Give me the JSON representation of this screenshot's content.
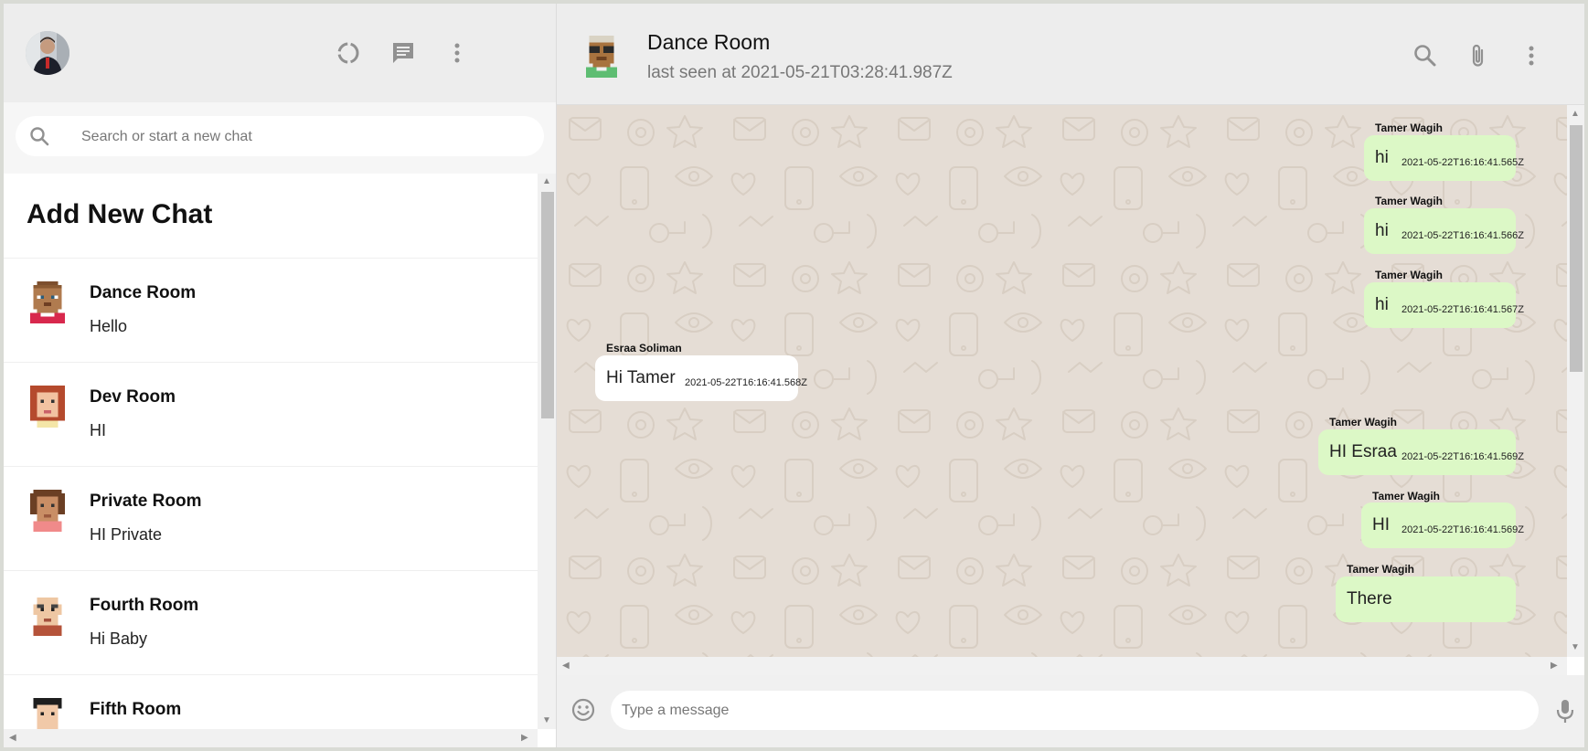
{
  "sidebar": {
    "search_placeholder": "Search or start a new chat",
    "add_new_chat_label": "Add New Chat",
    "chats": [
      {
        "name": "Dance Room",
        "last_message": "Hello",
        "avatar": "avatar-dark-skin-grey-hair"
      },
      {
        "name": "Dev Room",
        "last_message": "HI",
        "avatar": "avatar-red-hair"
      },
      {
        "name": "Private Room",
        "last_message": "HI Private",
        "avatar": "avatar-curly-brown-hair"
      },
      {
        "name": "Fourth Room",
        "last_message": "Hi Baby",
        "avatar": "avatar-bald-man"
      },
      {
        "name": "Fifth Room",
        "last_message": "",
        "avatar": "avatar-black-hair"
      }
    ]
  },
  "chat": {
    "title": "Dance Room",
    "status": "last seen at 2021-05-21T03:28:41.987Z",
    "composer_placeholder": "Type a message",
    "messages": [
      {
        "sender": "Tamer Wagih",
        "text": "hi",
        "time": "2021-05-22T16:16:41.565Z",
        "direction": "out"
      },
      {
        "sender": "Tamer Wagih",
        "text": "hi",
        "time": "2021-05-22T16:16:41.566Z",
        "direction": "out"
      },
      {
        "sender": "Tamer Wagih",
        "text": "hi",
        "time": "2021-05-22T16:16:41.567Z",
        "direction": "out"
      },
      {
        "sender": "Esraa Soliman",
        "text": "Hi Tamer",
        "time": "2021-05-22T16:16:41.568Z",
        "direction": "in"
      },
      {
        "sender": "Tamer Wagih",
        "text": "HI Esraa",
        "time": "2021-05-22T16:16:41.569Z",
        "direction": "out"
      },
      {
        "sender": "Tamer Wagih",
        "text": "HI",
        "time": "2021-05-22T16:16:41.569Z",
        "direction": "out"
      },
      {
        "sender": "Tamer Wagih",
        "text": "There",
        "time": "",
        "direction": "out"
      }
    ]
  },
  "colors": {
    "header_bg": "#ededed",
    "outgoing_bubble": "#dcf8c6",
    "incoming_bubble": "#ffffff",
    "chat_background": "#e5ddd5",
    "icon_grey": "#919191"
  }
}
